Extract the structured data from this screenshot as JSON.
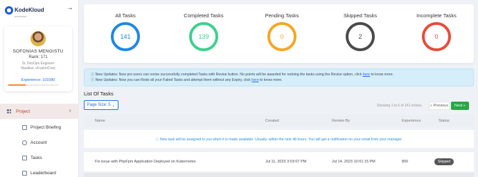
{
  "brand": {
    "name": "KodeKloud",
    "tagline": "ENGINEER"
  },
  "sidebar": {
    "collapse_icon": "arrow-right-icon",
    "profile": {
      "name": "SOFONIAS MENGISTU",
      "rank": "Rank: 171",
      "role": "Sr. DevOps Engineer",
      "org": "Nautilus, xFusionCorp",
      "experience": "Experience: 101080",
      "experience_progress": 0.35
    },
    "nav": {
      "project": "Project",
      "items": [
        "Project Briefing",
        "Account",
        "Tasks",
        "Leaderboard"
      ]
    }
  },
  "stats": [
    {
      "label": "All Tasks",
      "value": "141",
      "color": "#1e88e5"
    },
    {
      "label": "Completed Tasks",
      "value": "139",
      "color": "#3ecf8e"
    },
    {
      "label": "Pending Tasks",
      "value": "0",
      "color": "#f5a623"
    },
    {
      "label": "Skipped Tasks",
      "value": "2",
      "color": "#4a4a4a"
    },
    {
      "label": "Incomplete Tasks",
      "value": "0",
      "color": "#e74c3c"
    }
  ],
  "notice": {
    "line1_pre": "ⓘ New Updates: Now pro users can revise successfully completed Tasks with Revise button. No points will be awarded for redoing the tasks using the Revise option, click ",
    "line1_link": "here",
    "line1_post": " to know more.",
    "line2_pre": "ⓘ New Updates: Now you can Redo all your Failed Tasks and attempt them without any Expiry, click ",
    "line2_link": "here",
    "line2_post": " to know more."
  },
  "list": {
    "title": "List Of Tasks",
    "page_size": "Page Size: 5",
    "entries_info": "Showing 1 to 5 of 141 entries",
    "prev": "« Previous",
    "next": "Next »",
    "columns": [
      "Name",
      "Created",
      "Review By",
      "Experience",
      "Status"
    ],
    "info": "ⓘ New task will be assigned to you when it is made available. Usually, within the next 48 hours. You will get a notification on your email from your manager.",
    "rows": [
      {
        "name": "Fix issue with PhpFpm Application Deployed on Kubernetes",
        "created": "Jul 11, 2023 3:03:07 PM",
        "review_by": "Jul 14, 2023 10:01:15 PM",
        "experience": "800",
        "status": "Skipped"
      }
    ]
  },
  "colors": {
    "accent": "#1e6fe0",
    "nav_active_bg": "#f3e8e8",
    "nav_active_text": "#c0392b",
    "next_button": "#28a745"
  }
}
